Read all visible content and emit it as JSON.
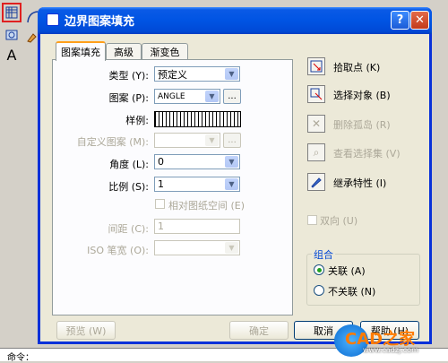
{
  "cad_toolbar": {
    "text_tool": "A"
  },
  "cad_command": {
    "prompt": "命令："
  },
  "dialog": {
    "title": "边界图案填充",
    "help": "?",
    "close": "✕"
  },
  "tabs": [
    {
      "label": "图案填充"
    },
    {
      "label": "高级"
    },
    {
      "label": "渐变色"
    }
  ],
  "fields": {
    "type": {
      "label": "类型 (Y):",
      "value": "预定义"
    },
    "pattern": {
      "label": "图案 (P):",
      "value": "ANGLE",
      "browse": "..."
    },
    "sample": {
      "label": "样例:"
    },
    "custom_pattern": {
      "label": "自定义图案 (M):",
      "browse": "..."
    },
    "angle": {
      "label": "角度 (L):",
      "value": "0"
    },
    "scale": {
      "label": "比例 (S):",
      "value": "1"
    },
    "relative_paper": {
      "label": "相对图纸空间 (E)"
    },
    "spacing": {
      "label": "间距 (C):",
      "value": "1"
    },
    "iso_pen": {
      "label": "ISO 笔宽 (O):"
    }
  },
  "side_actions": [
    {
      "label": "拾取点 (K)",
      "enabled": true
    },
    {
      "label": "选择对象 (B)",
      "enabled": true
    },
    {
      "label": "删除孤岛 (R)",
      "enabled": false
    },
    {
      "label": "查看选择集 (V)",
      "enabled": false
    },
    {
      "label": "继承特性 (I)",
      "enabled": true
    }
  ],
  "double": {
    "label": "双向 (U)"
  },
  "combine": {
    "title": "组合",
    "options": [
      {
        "label": "关联 (A)",
        "selected": true
      },
      {
        "label": "不关联 (N)",
        "selected": false
      }
    ]
  },
  "buttons": {
    "preview": "预览 (W)",
    "ok": "确定",
    "cancel": "取消",
    "help": "帮助 (H)"
  },
  "watermark": {
    "brand": "CAD之家",
    "url": "www.cadzj.com"
  }
}
